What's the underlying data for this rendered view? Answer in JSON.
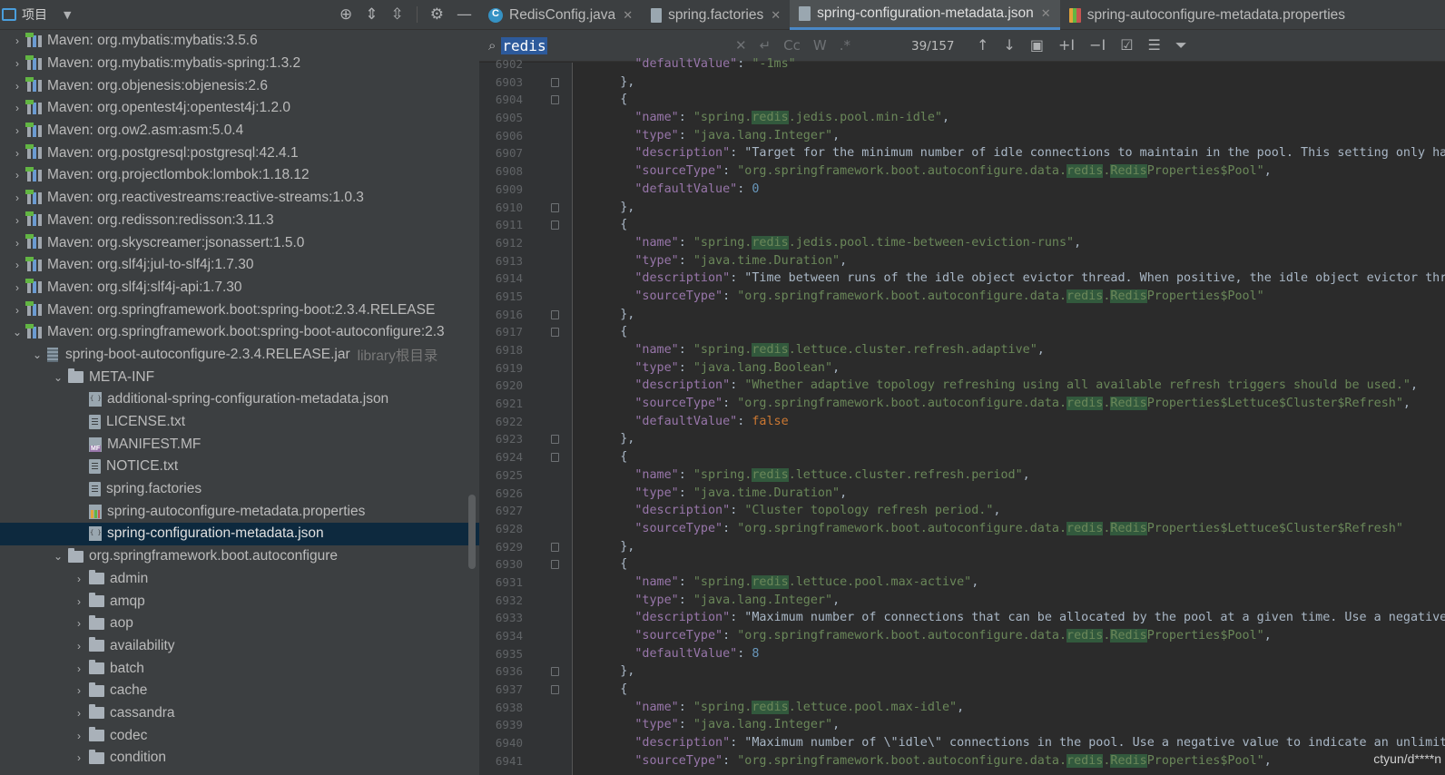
{
  "project_panel": {
    "title": "项目",
    "tree": [
      {
        "label": "Maven: org.mybatis:mybatis:3.5.6",
        "indent": 0,
        "arrow": "›",
        "icon": "lib"
      },
      {
        "label": "Maven: org.mybatis:mybatis-spring:1.3.2",
        "indent": 0,
        "arrow": "›",
        "icon": "lib"
      },
      {
        "label": "Maven: org.objenesis:objenesis:2.6",
        "indent": 0,
        "arrow": "›",
        "icon": "lib"
      },
      {
        "label": "Maven: org.opentest4j:opentest4j:1.2.0",
        "indent": 0,
        "arrow": "›",
        "icon": "lib"
      },
      {
        "label": "Maven: org.ow2.asm:asm:5.0.4",
        "indent": 0,
        "arrow": "›",
        "icon": "lib"
      },
      {
        "label": "Maven: org.postgresql:postgresql:42.4.1",
        "indent": 0,
        "arrow": "›",
        "icon": "lib"
      },
      {
        "label": "Maven: org.projectlombok:lombok:1.18.12",
        "indent": 0,
        "arrow": "›",
        "icon": "lib"
      },
      {
        "label": "Maven: org.reactivestreams:reactive-streams:1.0.3",
        "indent": 0,
        "arrow": "›",
        "icon": "lib"
      },
      {
        "label": "Maven: org.redisson:redisson:3.11.3",
        "indent": 0,
        "arrow": "›",
        "icon": "lib"
      },
      {
        "label": "Maven: org.skyscreamer:jsonassert:1.5.0",
        "indent": 0,
        "arrow": "›",
        "icon": "lib"
      },
      {
        "label": "Maven: org.slf4j:jul-to-slf4j:1.7.30",
        "indent": 0,
        "arrow": "›",
        "icon": "lib"
      },
      {
        "label": "Maven: org.slf4j:slf4j-api:1.7.30",
        "indent": 0,
        "arrow": "›",
        "icon": "lib"
      },
      {
        "label": "Maven: org.springframework.boot:spring-boot:2.3.4.RELEASE",
        "indent": 0,
        "arrow": "›",
        "icon": "lib"
      },
      {
        "label": "Maven: org.springframework.boot:spring-boot-autoconfigure:2.3",
        "indent": 0,
        "arrow": "⌄",
        "icon": "lib"
      },
      {
        "label": "spring-boot-autoconfigure-2.3.4.RELEASE.jar",
        "hint": "library根目录",
        "indent": 1,
        "arrow": "⌄",
        "icon": "jar"
      },
      {
        "label": "META-INF",
        "indent": 2,
        "arrow": "⌄",
        "icon": "fold"
      },
      {
        "label": "additional-spring-configuration-metadata.json",
        "indent": 3,
        "arrow": "",
        "icon": "json"
      },
      {
        "label": "LICENSE.txt",
        "indent": 3,
        "arrow": "",
        "icon": "file"
      },
      {
        "label": "MANIFEST.MF",
        "indent": 3,
        "arrow": "",
        "icon": "mf"
      },
      {
        "label": "NOTICE.txt",
        "indent": 3,
        "arrow": "",
        "icon": "file"
      },
      {
        "label": "spring.factories",
        "indent": 3,
        "arrow": "",
        "icon": "file"
      },
      {
        "label": "spring-autoconfigure-metadata.properties",
        "indent": 3,
        "arrow": "",
        "icon": "prop"
      },
      {
        "label": "spring-configuration-metadata.json",
        "indent": 3,
        "arrow": "",
        "icon": "json",
        "selected": true
      },
      {
        "label": "org.springframework.boot.autoconfigure",
        "indent": 2,
        "arrow": "⌄",
        "icon": "fold"
      },
      {
        "label": "admin",
        "indent": 3,
        "arrow": "›",
        "icon": "fold"
      },
      {
        "label": "amqp",
        "indent": 3,
        "arrow": "›",
        "icon": "fold"
      },
      {
        "label": "aop",
        "indent": 3,
        "arrow": "›",
        "icon": "fold"
      },
      {
        "label": "availability",
        "indent": 3,
        "arrow": "›",
        "icon": "fold"
      },
      {
        "label": "batch",
        "indent": 3,
        "arrow": "›",
        "icon": "fold"
      },
      {
        "label": "cache",
        "indent": 3,
        "arrow": "›",
        "icon": "fold"
      },
      {
        "label": "cassandra",
        "indent": 3,
        "arrow": "›",
        "icon": "fold"
      },
      {
        "label": "codec",
        "indent": 3,
        "arrow": "›",
        "icon": "fold"
      },
      {
        "label": "condition",
        "indent": 3,
        "arrow": "›",
        "icon": "fold"
      }
    ]
  },
  "tabs": [
    {
      "label": "RedisConfig.java",
      "icon": "cls"
    },
    {
      "label": "spring.factories",
      "icon": "fil"
    },
    {
      "label": "spring-configuration-metadata.json",
      "icon": "jsn",
      "active": true
    },
    {
      "label": "spring-autoconfigure-metadata.properties",
      "icon": "prp"
    }
  ],
  "find": {
    "query": "redis",
    "options": [
      "Cc",
      "W",
      ".*"
    ],
    "count": "39/157"
  },
  "code_lines": [
    {
      "n": "6902",
      "t": "      \"defaultValue\": \"-1ms\""
    },
    {
      "n": "6903",
      "t": "    },",
      "fold": true
    },
    {
      "n": "6904",
      "t": "    {",
      "fold": true
    },
    {
      "n": "6905",
      "t": "      \"name\": \"spring.redis.jedis.pool.min-idle\","
    },
    {
      "n": "6906",
      "t": "      \"type\": \"java.lang.Integer\","
    },
    {
      "n": "6907",
      "t": "      \"description\": \"Target for the minimum number of idle connections to maintain in the pool. This setting only has an"
    },
    {
      "n": "6908",
      "t": "      \"sourceType\": \"org.springframework.boot.autoconfigure.data.redis.RedisProperties$Pool\","
    },
    {
      "n": "6909",
      "t": "      \"defaultValue\": 0"
    },
    {
      "n": "6910",
      "t": "    },",
      "fold": true
    },
    {
      "n": "6911",
      "t": "    {",
      "fold": true
    },
    {
      "n": "6912",
      "t": "      \"name\": \"spring.redis.jedis.pool.time-between-eviction-runs\","
    },
    {
      "n": "6913",
      "t": "      \"type\": \"java.time.Duration\","
    },
    {
      "n": "6914",
      "t": "      \"description\": \"Time between runs of the idle object evictor thread. When positive, the idle object evictor thread"
    },
    {
      "n": "6915",
      "t": "      \"sourceType\": \"org.springframework.boot.autoconfigure.data.redis.RedisProperties$Pool\""
    },
    {
      "n": "6916",
      "t": "    },",
      "fold": true
    },
    {
      "n": "6917",
      "t": "    {",
      "fold": true
    },
    {
      "n": "6918",
      "t": "      \"name\": \"spring.redis.lettuce.cluster.refresh.adaptive\","
    },
    {
      "n": "6919",
      "t": "      \"type\": \"java.lang.Boolean\","
    },
    {
      "n": "6920",
      "t": "      \"description\": \"Whether adaptive topology refreshing using all available refresh triggers should be used.\","
    },
    {
      "n": "6921",
      "t": "      \"sourceType\": \"org.springframework.boot.autoconfigure.data.redis.RedisProperties$Lettuce$Cluster$Refresh\","
    },
    {
      "n": "6922",
      "t": "      \"defaultValue\": false"
    },
    {
      "n": "6923",
      "t": "    },",
      "fold": true
    },
    {
      "n": "6924",
      "t": "    {",
      "fold": true
    },
    {
      "n": "6925",
      "t": "      \"name\": \"spring.redis.lettuce.cluster.refresh.period\","
    },
    {
      "n": "6926",
      "t": "      \"type\": \"java.time.Duration\","
    },
    {
      "n": "6927",
      "t": "      \"description\": \"Cluster topology refresh period.\","
    },
    {
      "n": "6928",
      "t": "      \"sourceType\": \"org.springframework.boot.autoconfigure.data.redis.RedisProperties$Lettuce$Cluster$Refresh\""
    },
    {
      "n": "6929",
      "t": "    },",
      "fold": true
    },
    {
      "n": "6930",
      "t": "    {",
      "fold": true
    },
    {
      "n": "6931",
      "t": "      \"name\": \"spring.redis.lettuce.pool.max-active\","
    },
    {
      "n": "6932",
      "t": "      \"type\": \"java.lang.Integer\","
    },
    {
      "n": "6933",
      "t": "      \"description\": \"Maximum number of connections that can be allocated by the pool at a given time. Use a negative val"
    },
    {
      "n": "6934",
      "t": "      \"sourceType\": \"org.springframework.boot.autoconfigure.data.redis.RedisProperties$Pool\","
    },
    {
      "n": "6935",
      "t": "      \"defaultValue\": 8"
    },
    {
      "n": "6936",
      "t": "    },",
      "fold": true
    },
    {
      "n": "6937",
      "t": "    {",
      "fold": true
    },
    {
      "n": "6938",
      "t": "      \"name\": \"spring.redis.lettuce.pool.max-idle\","
    },
    {
      "n": "6939",
      "t": "      \"type\": \"java.lang.Integer\","
    },
    {
      "n": "6940",
      "t": "      \"description\": \"Maximum number of \\\"idle\\\" connections in the pool. Use a negative value to indicate an unlimited n"
    },
    {
      "n": "6941",
      "t": "      \"sourceType\": \"org.springframework.boot.autoconfigure.data.redis.RedisProperties$Pool\","
    }
  ],
  "watermark": "ctyun/d****n",
  "colors": {
    "keyword": "#9876aa",
    "string": "#6a8759",
    "number": "#6897bb",
    "literal": "#cc7832",
    "match": "#32593d",
    "selection": "#0d293e"
  }
}
